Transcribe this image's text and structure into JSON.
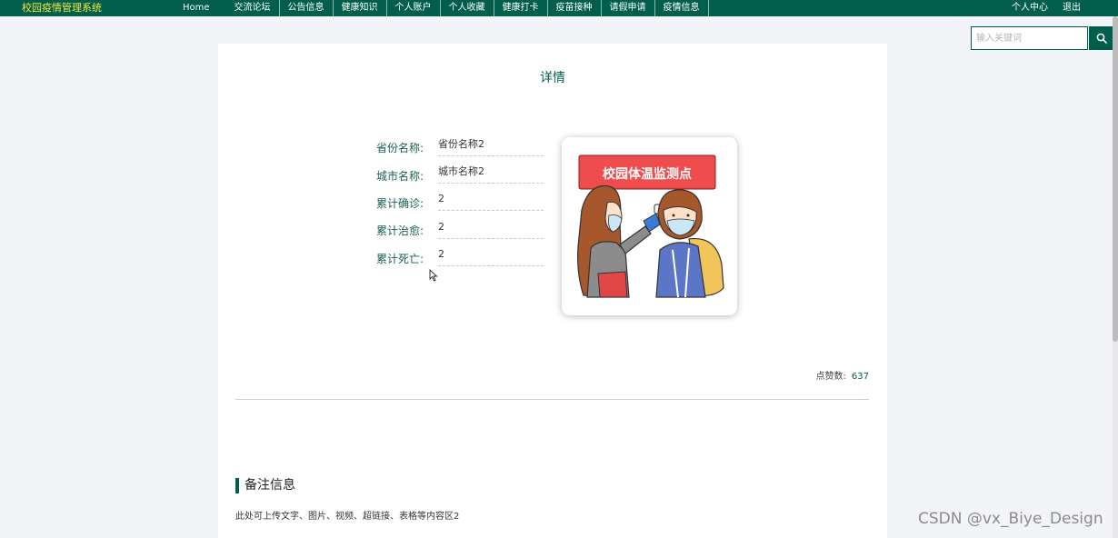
{
  "header": {
    "brand": "校园疫情管理系统",
    "nav": [
      "Home",
      "交流论坛",
      "公告信息",
      "健康知识",
      "个人账户",
      "个人收藏",
      "健康打卡",
      "疫苗接种",
      "请假申请",
      "疫情信息"
    ],
    "user_center": "个人中心",
    "logout": "退出"
  },
  "search": {
    "placeholder": "输入关键词",
    "value": ""
  },
  "detail": {
    "title": "详情",
    "fields": [
      {
        "label": "省份名称:",
        "value": "省份名称2"
      },
      {
        "label": "城市名称:",
        "value": "城市名称2"
      },
      {
        "label": "累计确诊:",
        "value": "2"
      },
      {
        "label": "累计治愈:",
        "value": "2"
      },
      {
        "label": "累计死亡:",
        "value": "2"
      }
    ],
    "image_banner": "校园体温监测点",
    "likes_label": "点赞数:",
    "likes_count": "637"
  },
  "remark": {
    "heading": "备注信息",
    "content": "此处可上传文字、图片、视频、超链接、表格等内容区2"
  },
  "watermark": "CSDN @vx_Biye_Design",
  "colors": {
    "primary": "#015e4c",
    "brand_text": "#f5e63a",
    "banner": "#ef4d4d",
    "background": "#f3f4f8"
  },
  "icons": [
    "search-icon",
    "mouse-cursor-icon"
  ]
}
